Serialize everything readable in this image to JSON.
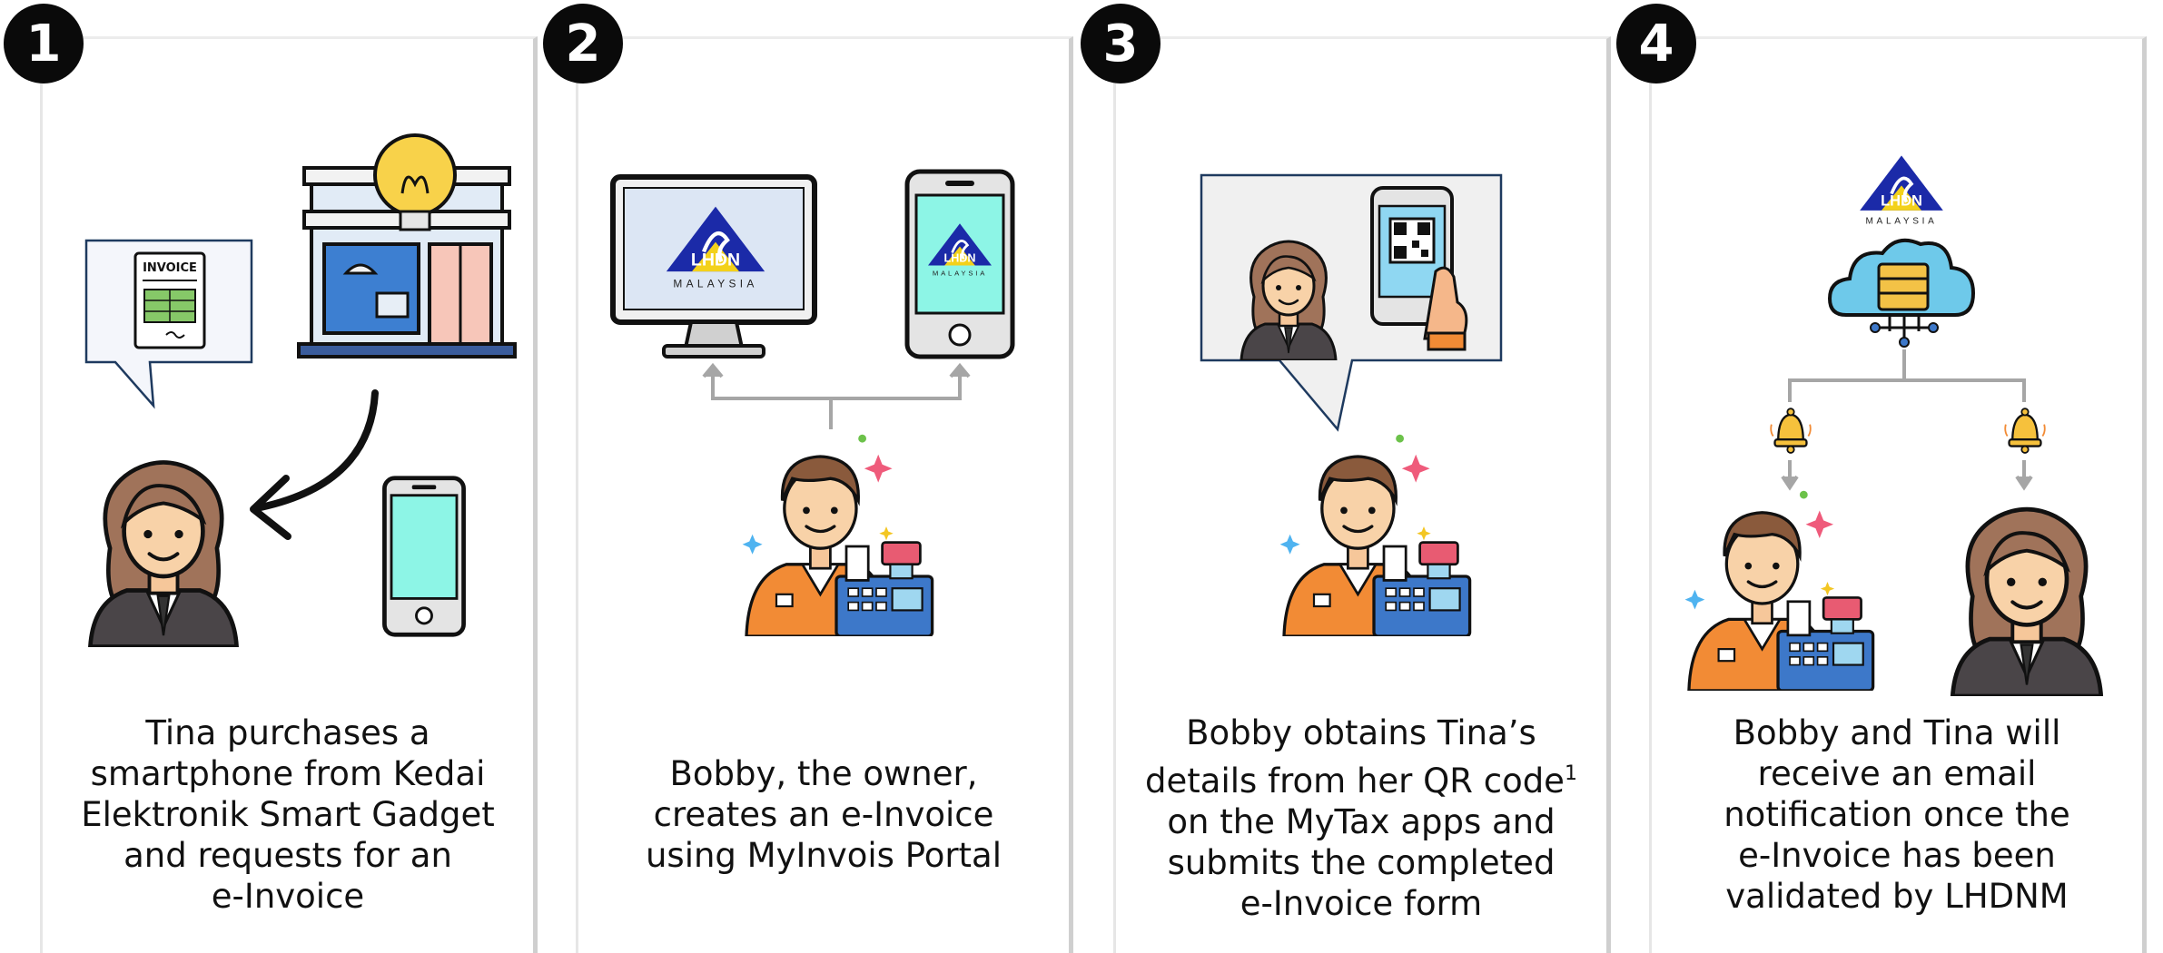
{
  "colors": {
    "accent_teal": "#8df5e6",
    "lhdn_blue": "#1b2aa8",
    "lhdn_yellow": "#f3d11b",
    "shirt_orange": "#f28b35",
    "register_blue": "#3d78c9",
    "arrow_gray": "#a6a6a6"
  },
  "steps": [
    {
      "number": "1",
      "caption_lines": [
        "Tina purchases a",
        "smartphone from Kedai",
        "Elektronik Smart Gadget",
        "and requests for an",
        "e-Invoice"
      ],
      "invoice_label": "INVOICE",
      "icons": [
        "invoice-bubble-icon",
        "shop-icon",
        "lightbulb-icon",
        "curved-arrow-icon",
        "woman-icon",
        "smartphone-icon"
      ]
    },
    {
      "number": "2",
      "caption_lines": [
        "Bobby, the owner,",
        "creates an e-Invoice",
        "using MyInvois Portal"
      ],
      "logo_text": "LHDN",
      "logo_subtext": "MALAYSIA",
      "icons": [
        "monitor-icon",
        "smartphone-icon",
        "cashier-man-icon"
      ]
    },
    {
      "number": "3",
      "caption_lines": [
        "Bobby obtains Tina’s",
        "details from her QR code",
        "on the MyTax apps and",
        "submits the completed",
        "e-Invoice form"
      ],
      "footnote_mark": "1",
      "icons": [
        "qr-bubble-icon",
        "woman-icon",
        "qr-phone-icon",
        "cashier-man-icon"
      ]
    },
    {
      "number": "4",
      "caption_lines": [
        "Bobby and Tina will",
        "receive an email",
        "notification once the",
        "e-Invoice has been",
        "validated by LHDNM"
      ],
      "logo_text": "LHDN",
      "logo_subtext": "MALAYSIA",
      "icons": [
        "lhdn-logo-icon",
        "cloud-server-icon",
        "bell-icon",
        "cashier-man-icon",
        "woman-icon"
      ]
    }
  ]
}
